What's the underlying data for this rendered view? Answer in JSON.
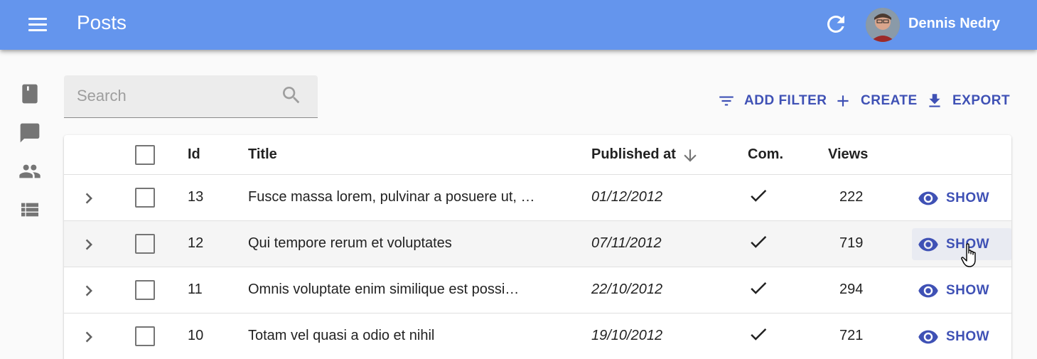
{
  "app": {
    "title": "Posts"
  },
  "user": {
    "name": "Dennis Nedry"
  },
  "search": {
    "placeholder": "Search"
  },
  "toolbar": {
    "add_filter": "ADD FILTER",
    "create": "CREATE",
    "export": "EXPORT"
  },
  "sidebar": {
    "items": [
      {
        "name": "posts",
        "icon": "book-icon"
      },
      {
        "name": "comments",
        "icon": "comment-icon"
      },
      {
        "name": "users",
        "icon": "people-icon"
      },
      {
        "name": "tags",
        "icon": "list-icon"
      }
    ]
  },
  "table": {
    "columns": {
      "id": "Id",
      "title": "Title",
      "published": "Published at",
      "com": "Com.",
      "views": "Views"
    },
    "sort": {
      "column": "Published at",
      "direction": "desc"
    },
    "rows": [
      {
        "id": "13",
        "title": "Fusce massa lorem, pulvinar a posuere ut, …",
        "published": "01/12/2012",
        "commentable": true,
        "views": "222",
        "action": "SHOW"
      },
      {
        "id": "12",
        "title": "Qui tempore rerum et voluptates",
        "published": "07/11/2012",
        "commentable": true,
        "views": "719",
        "action": "SHOW"
      },
      {
        "id": "11",
        "title": "Omnis voluptate enim similique est possi…",
        "published": "22/10/2012",
        "commentable": true,
        "views": "294",
        "action": "SHOW"
      },
      {
        "id": "10",
        "title": "Totam vel quasi a odio et nihil",
        "published": "19/10/2012",
        "commentable": true,
        "views": "721",
        "action": "SHOW"
      }
    ]
  },
  "colors": {
    "appbar": "#6495ed",
    "accent": "#3f51b5",
    "icon_grey": "#757575"
  }
}
